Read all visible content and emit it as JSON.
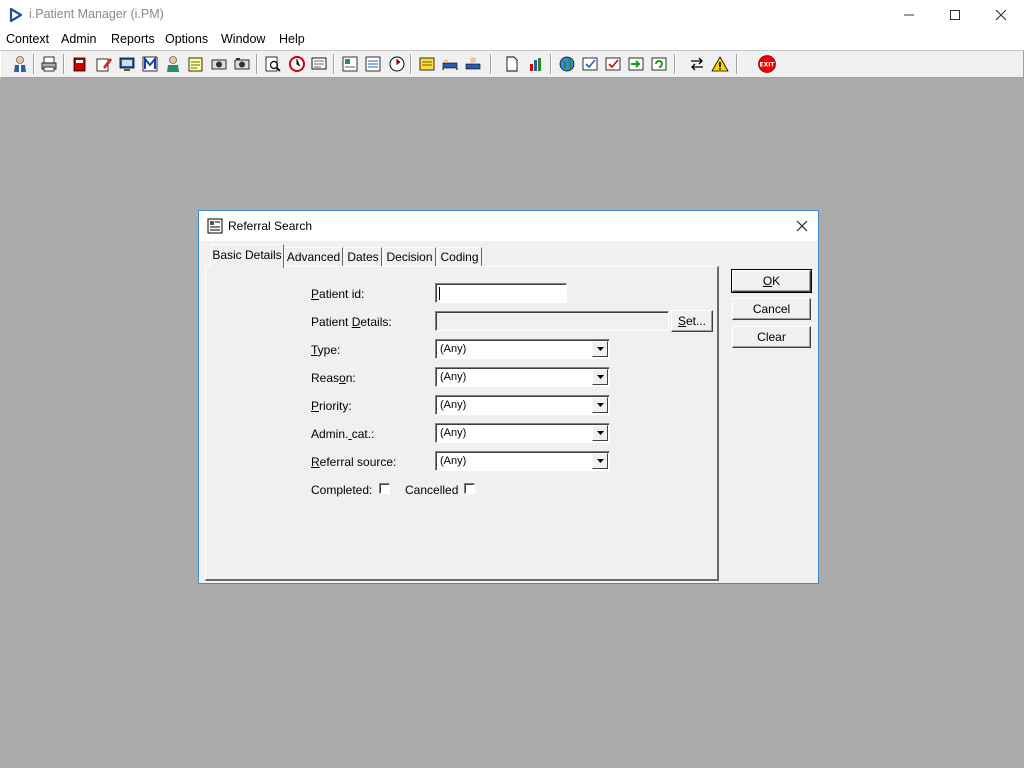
{
  "app": {
    "title": "i.Patient Manager (i.PM)"
  },
  "menu": [
    "Context",
    "Admin",
    "Reports",
    "Options",
    "Window",
    "Help"
  ],
  "toolbar_icons": [
    "patient-icon",
    "printer-icon",
    "book-icon",
    "edit-icon",
    "screen-icon",
    "letter-m-icon",
    "doctor-icon",
    "notes-icon",
    "camera-icon",
    "camera2-icon",
    "search-doc-icon",
    "clock-icon",
    "monitor-icon",
    "card-icon",
    "form-icon",
    "timer-icon",
    "note-icon",
    "bed-icon",
    "transfer-icon",
    "document-icon",
    "chart-icon",
    "globe-icon",
    "check-list-icon",
    "check-list2-icon",
    "arrows-green-icon",
    "refresh-green-icon",
    "swap-icon",
    "warning-icon",
    "exit-icon"
  ],
  "dialog": {
    "title": "Referral Search",
    "tabs": [
      "Basic Details",
      "Advanced",
      "Dates",
      "Decision",
      "Coding"
    ],
    "active_tab": "Basic Details",
    "fields": {
      "patient_id_label": "Patient id:",
      "patient_id_value": "",
      "patient_details_label": "Patient Details:",
      "set_button": "Set...",
      "type_label": "Type:",
      "type_value": "(Any)",
      "reason_label": "Reason:",
      "reason_value": "(Any)",
      "priority_label": "Priority:",
      "priority_value": "(Any)",
      "admin_cat_label": "Admin. cat.:",
      "admin_cat_value": "(Any)",
      "referral_source_label": "Referral source:",
      "referral_source_value": "(Any)",
      "completed_label": "Completed:",
      "cancelled_label": "Cancelled"
    },
    "buttons": {
      "ok": "OK",
      "cancel": "Cancel",
      "clear": "Clear"
    }
  }
}
